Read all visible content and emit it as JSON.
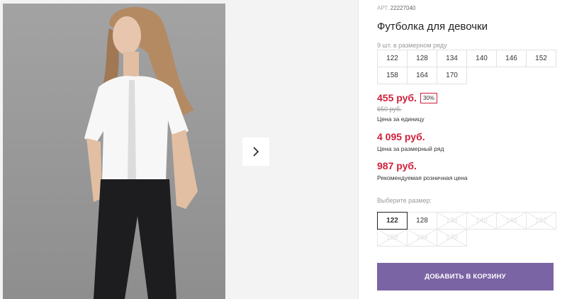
{
  "product": {
    "article_label": "АРТ.",
    "article_number": "22227040",
    "title": "Футболка для девочки",
    "series_note": "9 шт. в размерном ряду",
    "series_sizes": [
      "122",
      "128",
      "134",
      "140",
      "146",
      "152",
      "158",
      "164",
      "170"
    ]
  },
  "pricing": {
    "unit_price": "455 руб.",
    "discount": "30%",
    "old_price": "650 руб.",
    "unit_caption": "Цена за единицу",
    "series_price": "4 095 руб.",
    "series_caption": "Цена за размерный ряд",
    "retail_price": "987 руб.",
    "retail_caption": "Рекомендуемая розничная цена",
    "accent_color": "#d0203a"
  },
  "size_picker": {
    "label": "Выберите размер:",
    "options": [
      {
        "size": "122",
        "state": "selected"
      },
      {
        "size": "128",
        "state": "available"
      },
      {
        "size": "134",
        "state": "unavailable"
      },
      {
        "size": "140",
        "state": "unavailable"
      },
      {
        "size": "146",
        "state": "unavailable"
      },
      {
        "size": "152",
        "state": "unavailable"
      },
      {
        "size": "158",
        "state": "unavailable"
      },
      {
        "size": "164",
        "state": "unavailable"
      },
      {
        "size": "170",
        "state": "unavailable"
      }
    ]
  },
  "cart": {
    "button_label": "ДОБАВИТЬ В КОРЗИНУ",
    "button_color": "#7b64a4"
  },
  "gallery": {
    "next_icon": "chevron-right-icon"
  }
}
